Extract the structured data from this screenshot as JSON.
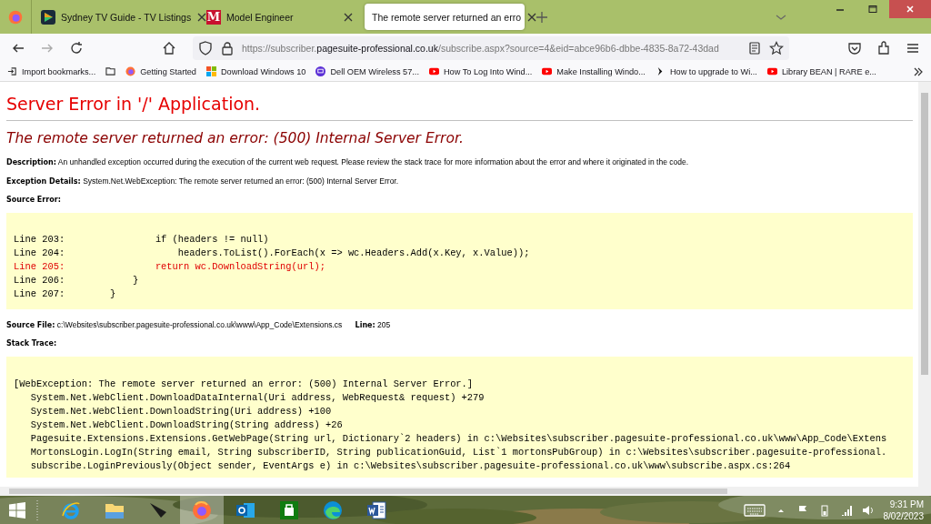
{
  "browser": {
    "tabs": [
      {
        "title": "Sydney TV Guide - TV Listings",
        "kind": "tv",
        "selected": false
      },
      {
        "title": "Model Engineer",
        "kind": "letter",
        "icon_letter": "M",
        "selected": false
      },
      {
        "title": "The remote server returned an erro",
        "selected": true
      }
    ],
    "address": {
      "prefix": "https://subscriber.",
      "host": "pagesuite-professional.co.uk",
      "path": "/subscribe.aspx?source=4&eid=abce96b6-dbbe-4835-8a72-43dad"
    },
    "bookmarks": [
      {
        "label": "Import bookmarks...",
        "kind": "import"
      },
      {
        "kind": "folder"
      },
      {
        "label": "Getting Started",
        "kind": "firefox"
      },
      {
        "label": "Download Windows 10",
        "kind": "windows"
      },
      {
        "label": "Dell OEM Wireless 57...",
        "kind": "dell"
      },
      {
        "label": "How To Log Into Wind...",
        "kind": "youtube"
      },
      {
        "label": "Make Installing Windo...",
        "kind": "youtube"
      },
      {
        "label": "How to upgrade to Wi...",
        "kind": "chevron"
      },
      {
        "label": "Library BEAN | RARE e...",
        "kind": "youtube"
      }
    ]
  },
  "page": {
    "title": "Server Error in '/' Application.",
    "heading": "The remote server returned an error: (500) Internal Server Error.",
    "description": {
      "label": "Description:",
      "text": "An unhandled exception occurred during the execution of the current web request. Please review the stack trace for more information about the error and where it originated in the code."
    },
    "exception": {
      "label": "Exception Details:",
      "text": "System.Net.WebException: The remote server returned an error: (500) Internal Server Error."
    },
    "source_error_label": "Source Error:",
    "source_lines": [
      {
        "text": "Line 203:                if (headers != null)",
        "highlighted": false
      },
      {
        "text": "Line 204:                    headers.ToList().ForEach(x => wc.Headers.Add(x.Key, x.Value));",
        "highlighted": false
      },
      {
        "text": "Line 205:                return wc.DownloadString(url);",
        "highlighted": true
      },
      {
        "text": "Line 206:            }",
        "highlighted": false
      },
      {
        "text": "Line 207:        }",
        "highlighted": false
      }
    ],
    "source_file": {
      "label": "Source File:",
      "path": "c:\\Websites\\subscriber.pagesuite-professional.co.uk\\www\\App_Code\\Extensions.cs",
      "line_label": "Line:",
      "line": "205"
    },
    "stack_label": "Stack Trace:",
    "stack_lines": [
      "[WebException: The remote server returned an error: (500) Internal Server Error.]",
      "   System.Net.WebClient.DownloadDataInternal(Uri address, WebRequest& request) +279",
      "   System.Net.WebClient.DownloadString(Uri address) +100",
      "   System.Net.WebClient.DownloadString(String address) +26",
      "   Pagesuite.Extensions.Extensions.GetWebPage(String url, Dictionary`2 headers) in c:\\Websites\\subscriber.pagesuite-professional.co.uk\\www\\App_Code\\Extens",
      "   MortonsLogin.LogIn(String email, String subscriberID, String publicationGuid, List`1 mortonsPubGroup) in c:\\Websites\\subscriber.pagesuite-professional.",
      "   subscribe.LoginPreviously(Object sender, EventArgs e) in c:\\Websites\\subscriber.pagesuite-professional.co.uk\\www\\subscribe.aspx.cs:264"
    ]
  },
  "taskbar": {
    "apps": [
      {
        "kind": "ie",
        "active": false
      },
      {
        "kind": "explorer",
        "active": false
      },
      {
        "kind": "bird",
        "active": false
      },
      {
        "kind": "firefox",
        "active": true
      },
      {
        "kind": "outlook",
        "active": false
      },
      {
        "kind": "store",
        "active": false
      },
      {
        "kind": "edge",
        "active": false
      },
      {
        "kind": "word",
        "active": false
      }
    ],
    "time": "9:31 PM",
    "date": "8/02/2023"
  }
}
